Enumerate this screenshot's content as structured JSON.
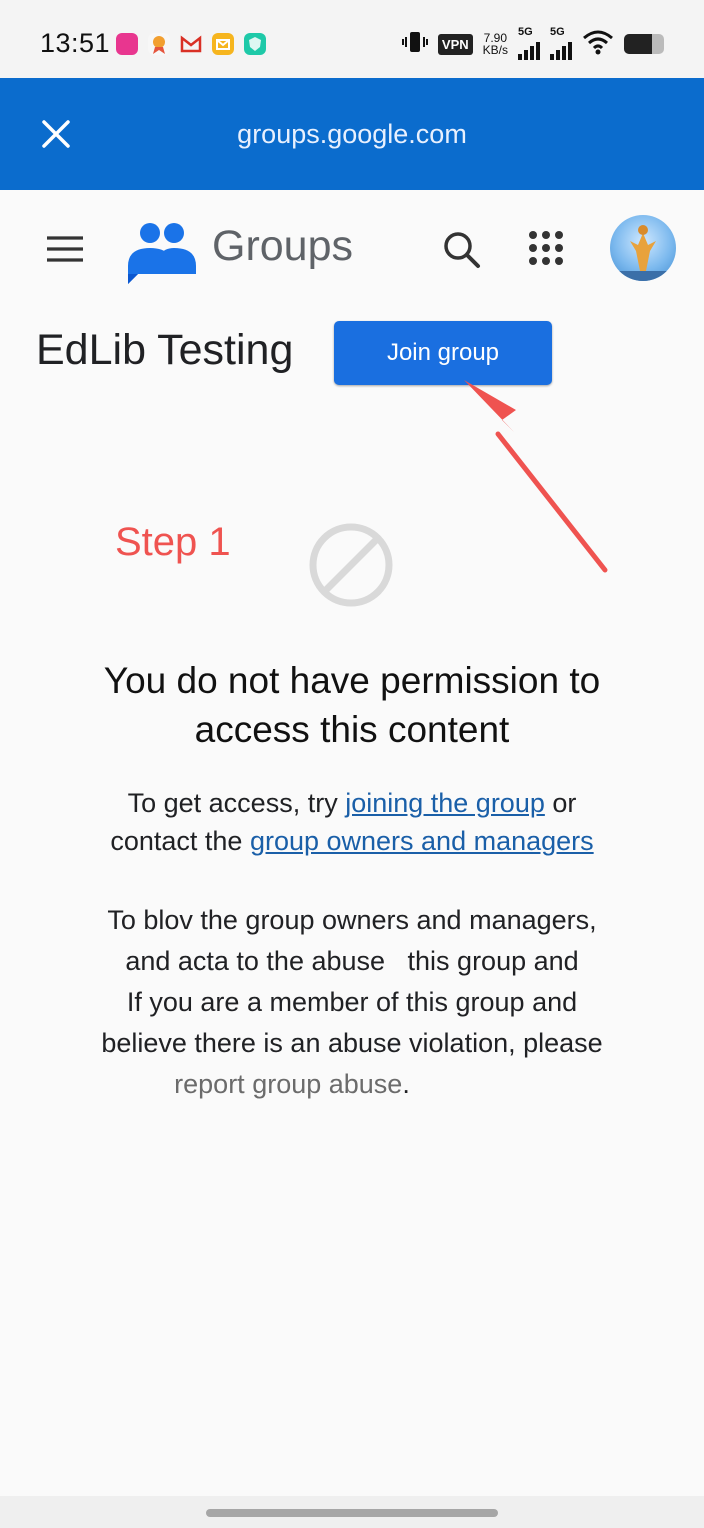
{
  "status_bar": {
    "time": "13:51",
    "vpn_label": "VPN",
    "net_speed_value": "7.90",
    "net_speed_unit": "KB/s",
    "network_type_1": "5G",
    "network_type_2": "5G",
    "battery_level": 0.7,
    "notification_icons": [
      "video-app-icon",
      "reward-app-icon",
      "gmail-icon",
      "mail-app-icon",
      "shield-app-icon"
    ]
  },
  "browser": {
    "url": "groups.google.com"
  },
  "app_bar": {
    "product_name": "Groups"
  },
  "group": {
    "name": "EdLib Testing",
    "join_label": "Join group"
  },
  "annotation": {
    "step_label": "Step 1",
    "color": "#ef5350"
  },
  "content": {
    "title_line1": "You do not have permission to",
    "title_line2": "access this content",
    "access_prefix": "To get access, try ",
    "join_link": "joining the group",
    "access_mid": " or",
    "contact_prefix": "contact the ",
    "owners_link": "group owners and managers",
    "abuse_line1": "To blov the group owners and managers,",
    "abuse_line2": "and acta to the abuse   this group and",
    "abuse_line3": "If you are a member of this group and",
    "abuse_line4": "believe there is an abuse violation, please",
    "report_link": "report group abuse",
    "report_suffix": "."
  },
  "colors": {
    "header_blue": "#0b6ccd",
    "button_blue": "#1a6fe0",
    "link_blue": "#1a5fa8"
  }
}
